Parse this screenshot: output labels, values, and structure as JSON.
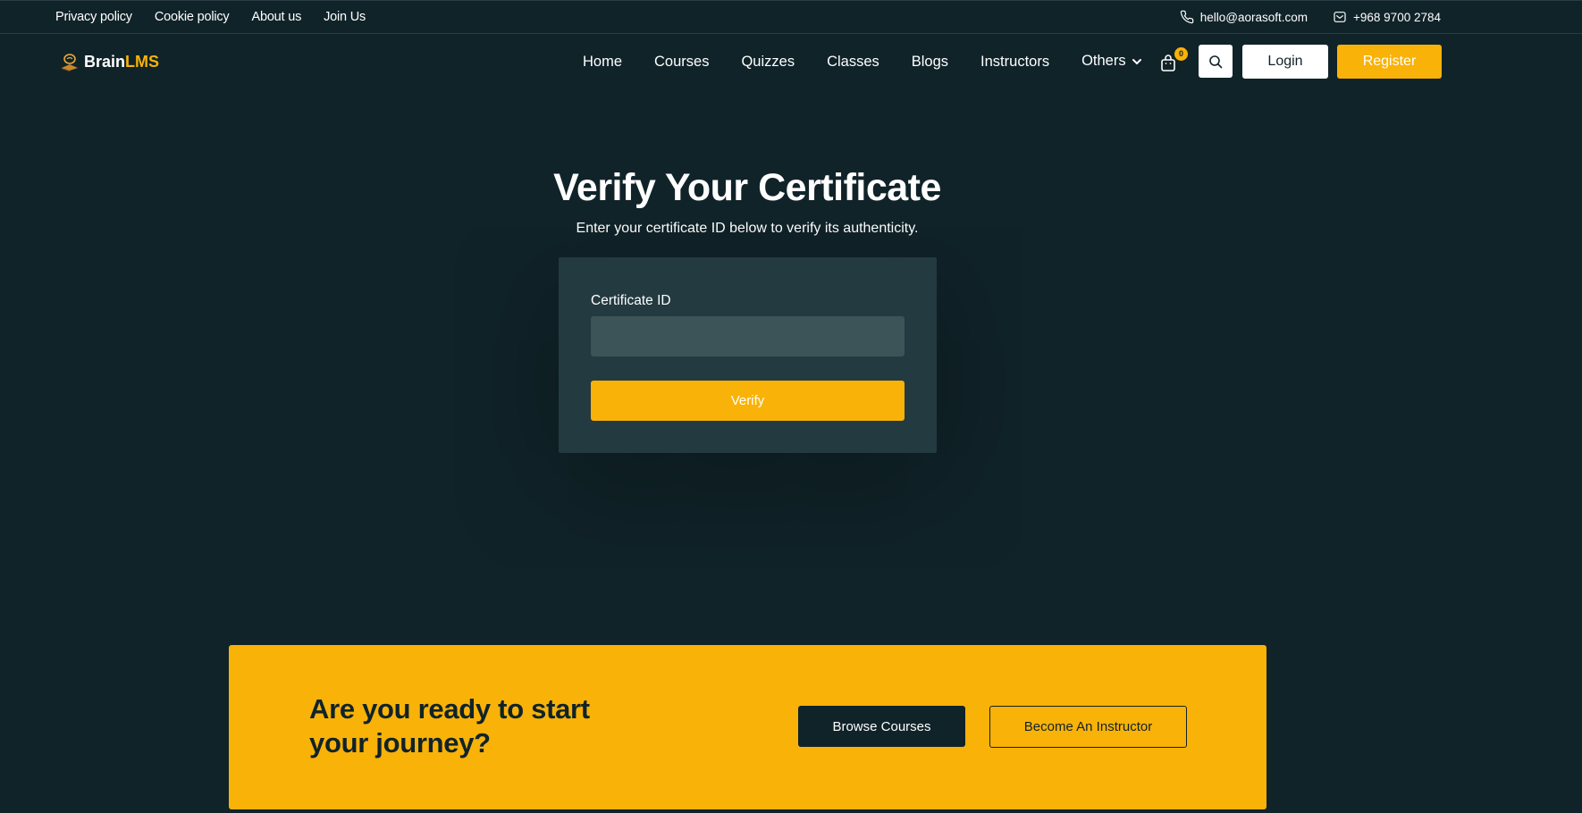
{
  "topbar": {
    "links": [
      "Privacy policy",
      "Cookie policy",
      "About us",
      "Join Us"
    ],
    "email": "hello@aorasoft.com",
    "phone": "+968 9700 2784",
    "phone_icon": "phone-icon",
    "mail_icon": "mail-icon"
  },
  "header": {
    "logo_brain": "Brain",
    "logo_lms": "LMS",
    "nav": [
      "Home",
      "Courses",
      "Quizzes",
      "Classes",
      "Blogs",
      "Instructors",
      "Others"
    ],
    "cart_count": "0",
    "login_label": "Login",
    "register_label": "Register"
  },
  "hero": {
    "title": "Verify Your Certificate",
    "subtitle": "Enter your certificate ID below to verify its authenticity.",
    "field_label": "Certificate ID",
    "field_value": "",
    "verify_label": "Verify"
  },
  "cta": {
    "heading": "Are you ready to start your journey?",
    "browse_label": "Browse Courses",
    "instructor_label": "Become An Instructor"
  },
  "colors": {
    "background": "#102329",
    "accent": "#f9b208",
    "card": "#233a40",
    "input": "#3c5358"
  }
}
